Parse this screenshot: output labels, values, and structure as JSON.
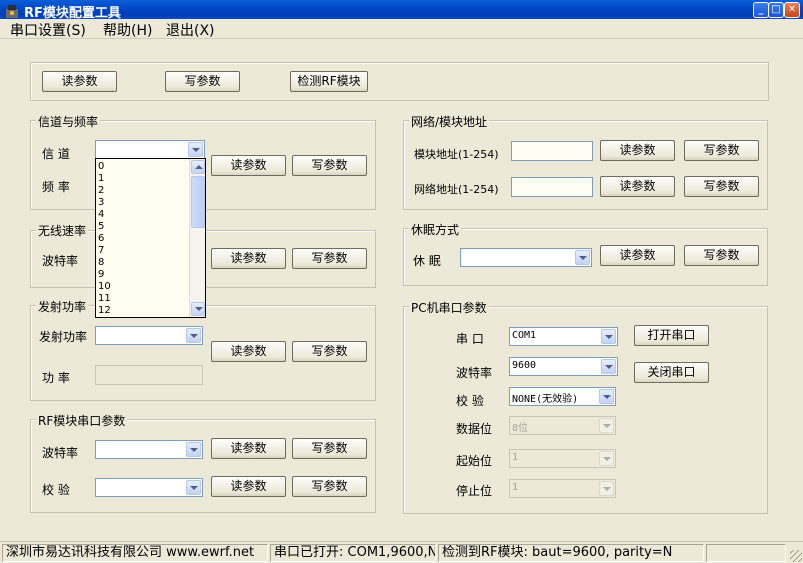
{
  "window": {
    "title": "RF模块配置工具"
  },
  "menu": {
    "items": [
      "串口设置(S)",
      "帮助(H)",
      "退出(X)"
    ]
  },
  "top_buttons": {
    "read": "读参数",
    "write": "写参数",
    "detect": "检测RF模块"
  },
  "channel_group": {
    "title": "信道与频率",
    "channel_label": "信  道",
    "freq_label": "频  率",
    "channel_value": "",
    "read": "读参数",
    "write": "写参数",
    "dropdown_options": [
      "0",
      "1",
      "2",
      "3",
      "4",
      "5",
      "6",
      "7",
      "8",
      "9",
      "10",
      "11",
      "12"
    ]
  },
  "rate_group": {
    "title": "无线速率",
    "label": "波特率",
    "read": "读参数",
    "write": "写参数"
  },
  "power_group": {
    "title": "发射功率",
    "power_label": "发射功率",
    "watt_label": "功  率",
    "read": "读参数",
    "write": "写参数"
  },
  "rf_serial_group": {
    "title": "RF模块串口参数",
    "baud_label": "波特率",
    "parity_label": "校  验",
    "read": "读参数",
    "write": "写参数"
  },
  "network_group": {
    "title": "网络/模块地址",
    "module_addr_label": "模块地址(1-254)",
    "network_addr_label": "网络地址(1-254)",
    "read": "读参数",
    "write": "写参数"
  },
  "sleep_group": {
    "title": "休眠方式",
    "label": "休  眠",
    "read": "读参数",
    "write": "写参数"
  },
  "pc_serial_group": {
    "title": "PC机串口参数",
    "port_label": "串  口",
    "port_value": "COM1",
    "baud_label": "波特率",
    "baud_value": "9600",
    "parity_label": "校  验",
    "parity_value": "NONE(无效验)",
    "databits_label": "数据位",
    "databits_value": "8位",
    "startbit_label": "起始位",
    "startbit_value": "1",
    "stopbit_label": "停止位",
    "stopbit_value": "1",
    "open": "打开串口",
    "close": "关闭串口"
  },
  "status": {
    "company": "深圳市易达讯科技有限公司 www.ewrf.net",
    "port_status": "串口已打开: COM1,9600,N",
    "detect_status": "检测到RF模块: baut=9600, parity=N"
  }
}
